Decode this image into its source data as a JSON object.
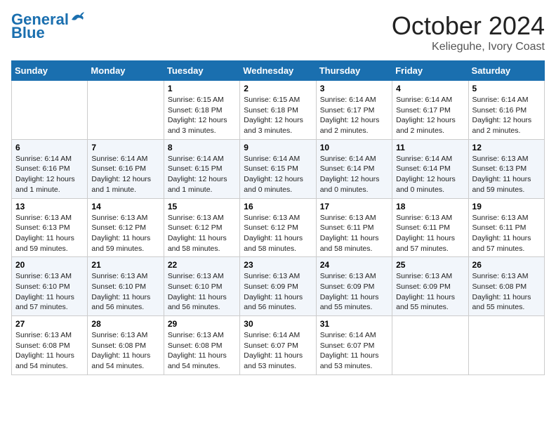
{
  "header": {
    "logo_line1": "General",
    "logo_line2": "Blue",
    "month": "October 2024",
    "location": "Kelieguhe, Ivory Coast"
  },
  "days_of_week": [
    "Sunday",
    "Monday",
    "Tuesday",
    "Wednesday",
    "Thursday",
    "Friday",
    "Saturday"
  ],
  "weeks": [
    [
      {
        "day": "",
        "info": ""
      },
      {
        "day": "",
        "info": ""
      },
      {
        "day": "1",
        "info": "Sunrise: 6:15 AM\nSunset: 6:18 PM\nDaylight: 12 hours and 3 minutes."
      },
      {
        "day": "2",
        "info": "Sunrise: 6:15 AM\nSunset: 6:18 PM\nDaylight: 12 hours and 3 minutes."
      },
      {
        "day": "3",
        "info": "Sunrise: 6:14 AM\nSunset: 6:17 PM\nDaylight: 12 hours and 2 minutes."
      },
      {
        "day": "4",
        "info": "Sunrise: 6:14 AM\nSunset: 6:17 PM\nDaylight: 12 hours and 2 minutes."
      },
      {
        "day": "5",
        "info": "Sunrise: 6:14 AM\nSunset: 6:16 PM\nDaylight: 12 hours and 2 minutes."
      }
    ],
    [
      {
        "day": "6",
        "info": "Sunrise: 6:14 AM\nSunset: 6:16 PM\nDaylight: 12 hours and 1 minute."
      },
      {
        "day": "7",
        "info": "Sunrise: 6:14 AM\nSunset: 6:16 PM\nDaylight: 12 hours and 1 minute."
      },
      {
        "day": "8",
        "info": "Sunrise: 6:14 AM\nSunset: 6:15 PM\nDaylight: 12 hours and 1 minute."
      },
      {
        "day": "9",
        "info": "Sunrise: 6:14 AM\nSunset: 6:15 PM\nDaylight: 12 hours and 0 minutes."
      },
      {
        "day": "10",
        "info": "Sunrise: 6:14 AM\nSunset: 6:14 PM\nDaylight: 12 hours and 0 minutes."
      },
      {
        "day": "11",
        "info": "Sunrise: 6:14 AM\nSunset: 6:14 PM\nDaylight: 12 hours and 0 minutes."
      },
      {
        "day": "12",
        "info": "Sunrise: 6:13 AM\nSunset: 6:13 PM\nDaylight: 11 hours and 59 minutes."
      }
    ],
    [
      {
        "day": "13",
        "info": "Sunrise: 6:13 AM\nSunset: 6:13 PM\nDaylight: 11 hours and 59 minutes."
      },
      {
        "day": "14",
        "info": "Sunrise: 6:13 AM\nSunset: 6:12 PM\nDaylight: 11 hours and 59 minutes."
      },
      {
        "day": "15",
        "info": "Sunrise: 6:13 AM\nSunset: 6:12 PM\nDaylight: 11 hours and 58 minutes."
      },
      {
        "day": "16",
        "info": "Sunrise: 6:13 AM\nSunset: 6:12 PM\nDaylight: 11 hours and 58 minutes."
      },
      {
        "day": "17",
        "info": "Sunrise: 6:13 AM\nSunset: 6:11 PM\nDaylight: 11 hours and 58 minutes."
      },
      {
        "day": "18",
        "info": "Sunrise: 6:13 AM\nSunset: 6:11 PM\nDaylight: 11 hours and 57 minutes."
      },
      {
        "day": "19",
        "info": "Sunrise: 6:13 AM\nSunset: 6:11 PM\nDaylight: 11 hours and 57 minutes."
      }
    ],
    [
      {
        "day": "20",
        "info": "Sunrise: 6:13 AM\nSunset: 6:10 PM\nDaylight: 11 hours and 57 minutes."
      },
      {
        "day": "21",
        "info": "Sunrise: 6:13 AM\nSunset: 6:10 PM\nDaylight: 11 hours and 56 minutes."
      },
      {
        "day": "22",
        "info": "Sunrise: 6:13 AM\nSunset: 6:10 PM\nDaylight: 11 hours and 56 minutes."
      },
      {
        "day": "23",
        "info": "Sunrise: 6:13 AM\nSunset: 6:09 PM\nDaylight: 11 hours and 56 minutes."
      },
      {
        "day": "24",
        "info": "Sunrise: 6:13 AM\nSunset: 6:09 PM\nDaylight: 11 hours and 55 minutes."
      },
      {
        "day": "25",
        "info": "Sunrise: 6:13 AM\nSunset: 6:09 PM\nDaylight: 11 hours and 55 minutes."
      },
      {
        "day": "26",
        "info": "Sunrise: 6:13 AM\nSunset: 6:08 PM\nDaylight: 11 hours and 55 minutes."
      }
    ],
    [
      {
        "day": "27",
        "info": "Sunrise: 6:13 AM\nSunset: 6:08 PM\nDaylight: 11 hours and 54 minutes."
      },
      {
        "day": "28",
        "info": "Sunrise: 6:13 AM\nSunset: 6:08 PM\nDaylight: 11 hours and 54 minutes."
      },
      {
        "day": "29",
        "info": "Sunrise: 6:13 AM\nSunset: 6:08 PM\nDaylight: 11 hours and 54 minutes."
      },
      {
        "day": "30",
        "info": "Sunrise: 6:14 AM\nSunset: 6:07 PM\nDaylight: 11 hours and 53 minutes."
      },
      {
        "day": "31",
        "info": "Sunrise: 6:14 AM\nSunset: 6:07 PM\nDaylight: 11 hours and 53 minutes."
      },
      {
        "day": "",
        "info": ""
      },
      {
        "day": "",
        "info": ""
      }
    ]
  ]
}
